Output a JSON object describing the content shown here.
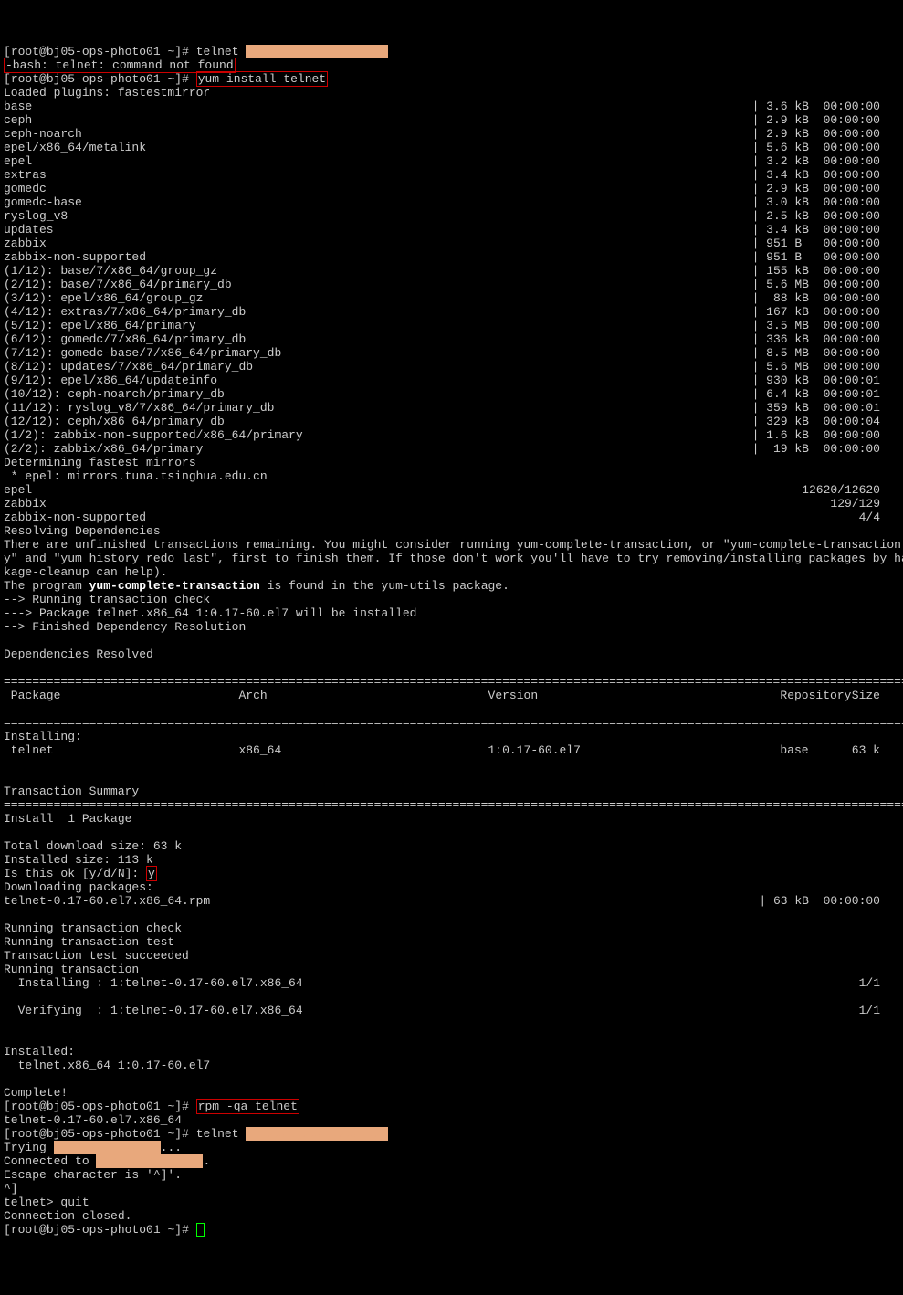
{
  "hostname": "bj05-ops-photo01",
  "prompt_user": "root",
  "cmd1": "telnet",
  "err1": "-bash: telnet: command not found",
  "cmd2": "yum install telnet",
  "loaded_plugins": "Loaded plugins: fastestmirror",
  "repos": [
    {
      "name": "base",
      "size": "3.6 kB",
      "time": "00:00:00"
    },
    {
      "name": "ceph",
      "size": "2.9 kB",
      "time": "00:00:00"
    },
    {
      "name": "ceph-noarch",
      "size": "2.9 kB",
      "time": "00:00:00"
    },
    {
      "name": "epel/x86_64/metalink",
      "size": "5.6 kB",
      "time": "00:00:00"
    },
    {
      "name": "epel",
      "size": "3.2 kB",
      "time": "00:00:00"
    },
    {
      "name": "extras",
      "size": "3.4 kB",
      "time": "00:00:00"
    },
    {
      "name": "gomedc",
      "size": "2.9 kB",
      "time": "00:00:00"
    },
    {
      "name": "gomedc-base",
      "size": "3.0 kB",
      "time": "00:00:00"
    },
    {
      "name": "ryslog_v8",
      "size": "2.5 kB",
      "time": "00:00:00"
    },
    {
      "name": "updates",
      "size": "3.4 kB",
      "time": "00:00:00"
    },
    {
      "name": "zabbix",
      "size": "951 B ",
      "time": "00:00:00"
    },
    {
      "name": "zabbix-non-supported",
      "size": "951 B ",
      "time": "00:00:00"
    },
    {
      "name": "(1/12): base/7/x86_64/group_gz",
      "size": "155 kB",
      "time": "00:00:00"
    },
    {
      "name": "(2/12): base/7/x86_64/primary_db",
      "size": "5.6 MB",
      "time": "00:00:00"
    },
    {
      "name": "(3/12): epel/x86_64/group_gz",
      "size": " 88 kB",
      "time": "00:00:00"
    },
    {
      "name": "(4/12): extras/7/x86_64/primary_db",
      "size": "167 kB",
      "time": "00:00:00"
    },
    {
      "name": "(5/12): epel/x86_64/primary",
      "size": "3.5 MB",
      "time": "00:00:00"
    },
    {
      "name": "(6/12): gomedc/7/x86_64/primary_db",
      "size": "336 kB",
      "time": "00:00:00"
    },
    {
      "name": "(7/12): gomedc-base/7/x86_64/primary_db",
      "size": "8.5 MB",
      "time": "00:00:00"
    },
    {
      "name": "(8/12): updates/7/x86_64/primary_db",
      "size": "5.6 MB",
      "time": "00:00:00"
    },
    {
      "name": "(9/12): epel/x86_64/updateinfo",
      "size": "930 kB",
      "time": "00:00:01"
    },
    {
      "name": "(10/12): ceph-noarch/primary_db",
      "size": "6.4 kB",
      "time": "00:00:01"
    },
    {
      "name": "(11/12): ryslog_v8/7/x86_64/primary_db",
      "size": "359 kB",
      "time": "00:00:01"
    },
    {
      "name": "(12/12): ceph/x86_64/primary_db",
      "size": "329 kB",
      "time": "00:00:04"
    },
    {
      "name": "(1/2): zabbix-non-supported/x86_64/primary",
      "size": "1.6 kB",
      "time": "00:00:00"
    },
    {
      "name": "(2/2): zabbix/x86_64/primary",
      "size": " 19 kB",
      "time": "00:00:00"
    }
  ],
  "determining": "Determining fastest mirrors",
  "mirror": " * epel: mirrors.tuna.tsinghua.edu.cn",
  "counts": [
    {
      "name": "epel",
      "val": "12620/12620"
    },
    {
      "name": "zabbix",
      "val": "129/129"
    },
    {
      "name": "zabbix-non-supported",
      "val": "4/4"
    }
  ],
  "resolving": "Resolving Dependencies",
  "unfinished": "There are unfinished transactions remaining. You might consider running yum-complete-transaction, or \"yum-complete-transaction --cleanup-onl\ny\" and \"yum history redo last\", first to finish them. If those don't work you'll have to try removing/installing packages by hand (maybe pac\nkage-cleanup can help).",
  "program_pre": "The program ",
  "program_bold": "yum-complete-transaction",
  "program_post": " is found in the yum-utils package.",
  "running_check": "--> Running transaction check",
  "pkg_line": "---> Package telnet.x86_64 1:0.17-60.el7 will be installed",
  "finished_dep": "--> Finished Dependency Resolution",
  "dep_resolved": "Dependencies Resolved",
  "hdr_package": " Package",
  "hdr_arch": "Arch",
  "hdr_version": "Version",
  "hdr_repo": "Repository",
  "hdr_size": "Size",
  "installing": "Installing:",
  "row_pkg": " telnet",
  "row_arch": "x86_64",
  "row_ver": "1:0.17-60.el7",
  "row_repo": "base",
  "row_size": "63 k",
  "tx_summary": "Transaction Summary",
  "install_count": "Install  1 Package",
  "total_dl": "Total download size: 63 k",
  "installed_size": "Installed size: 113 k",
  "is_ok": "Is this ok [y/d/N]: ",
  "y_answer": "y",
  "dl_pkgs": "Downloading packages:",
  "rpm_row_name": "telnet-0.17-60.el7.x86_64.rpm",
  "rpm_row_size": " 63 kB",
  "rpm_row_time": "00:00:00",
  "run_check2": "Running transaction check",
  "run_test": "Running transaction test",
  "test_succ": "Transaction test succeeded",
  "run_tx": "Running transaction",
  "installing_line": "  Installing : 1:telnet-0.17-60.el7.x86_64",
  "installing_count": "1/1",
  "verifying_line": "  Verifying  : 1:telnet-0.17-60.el7.x86_64",
  "verifying_count": "1/1",
  "installed_hdr": "Installed:",
  "installed_pkg": "  telnet.x86_64 1:0.17-60.el7",
  "complete": "Complete!",
  "cmd3": "rpm -qa telnet",
  "rpm_out": "telnet-0.17-60.el7.x86_64",
  "cmd4": "telnet",
  "trying": "Trying ",
  "trying_suffix": "...",
  "connected": "Connected to ",
  "connected_suffix": ".",
  "escape": "Escape character is '^]'.",
  "ctrl": "^]",
  "telnet_prompt": "telnet> ",
  "quit": "quit",
  "closed": "Connection closed."
}
